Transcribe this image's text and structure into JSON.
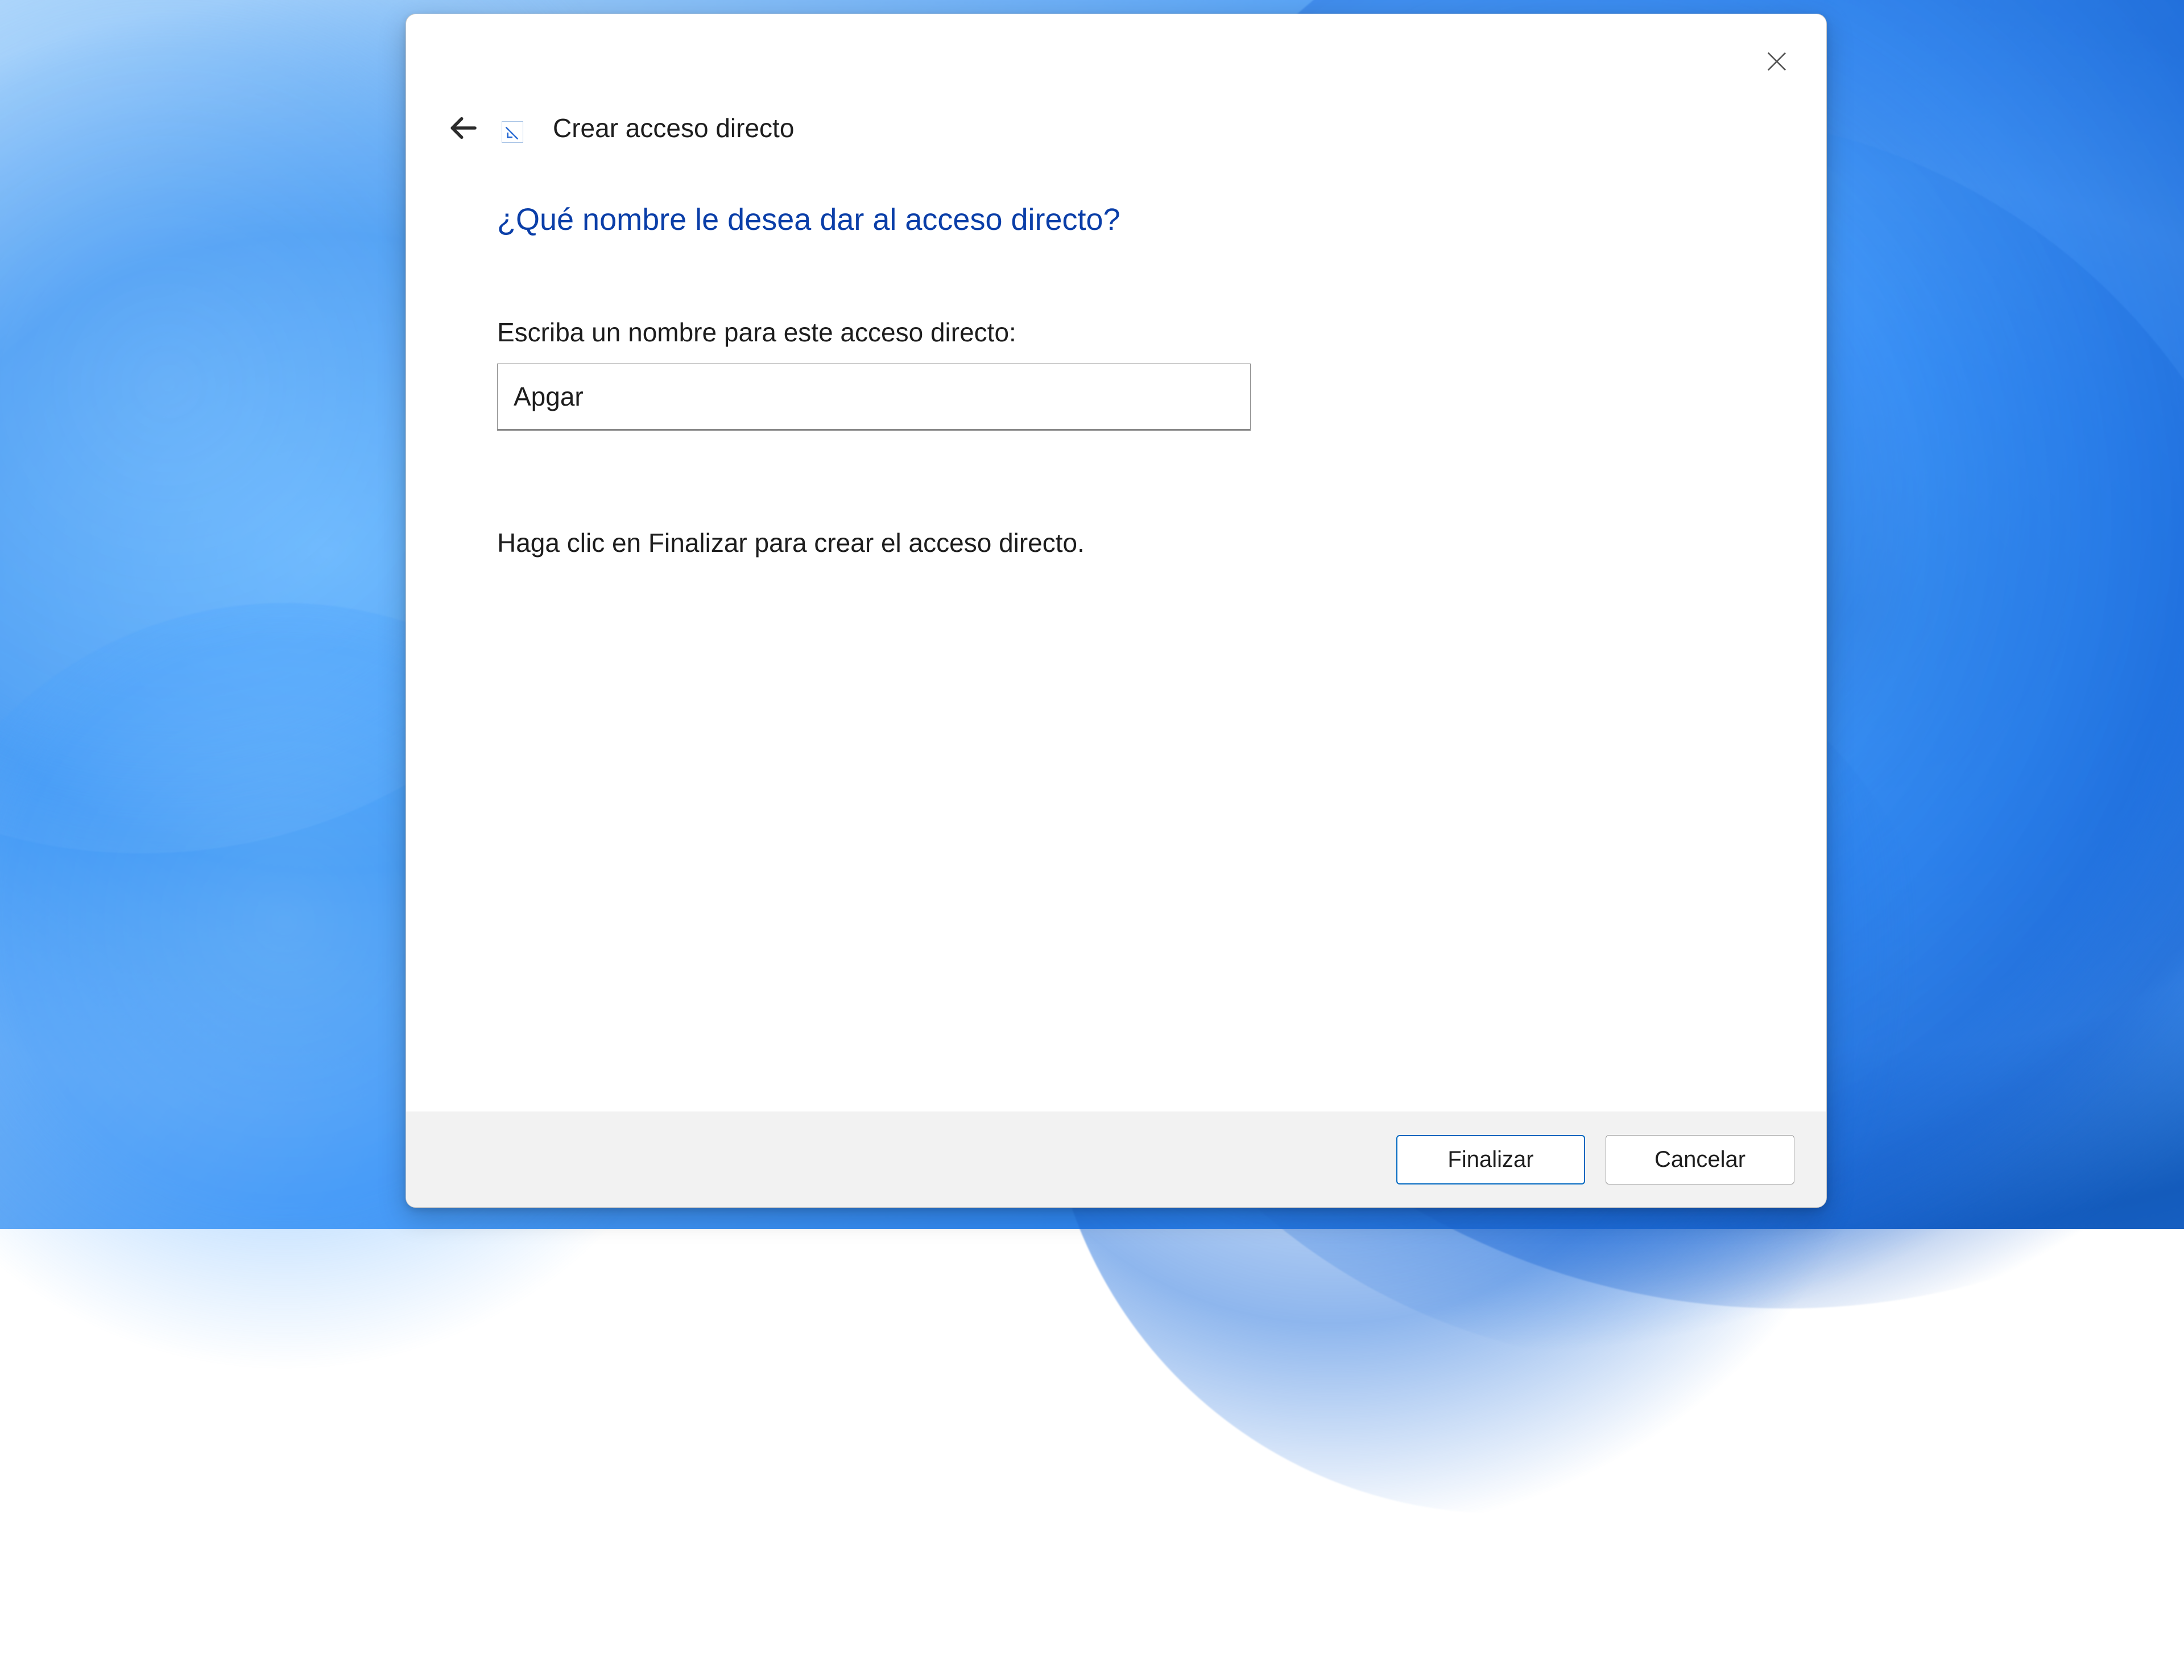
{
  "dialog": {
    "title": "Crear acceso directo",
    "heading": "¿Qué nombre le desea dar al acceso directo?",
    "field_label": "Escriba un nombre para este acceso directo:",
    "name_value": "Apgar",
    "instruction": "Haga clic en Finalizar para crear el acceso directo.",
    "buttons": {
      "finish": "Finalizar",
      "cancel": "Cancelar"
    }
  },
  "colors": {
    "accent": "#0067c0",
    "heading_blue": "#0a3ea8"
  }
}
